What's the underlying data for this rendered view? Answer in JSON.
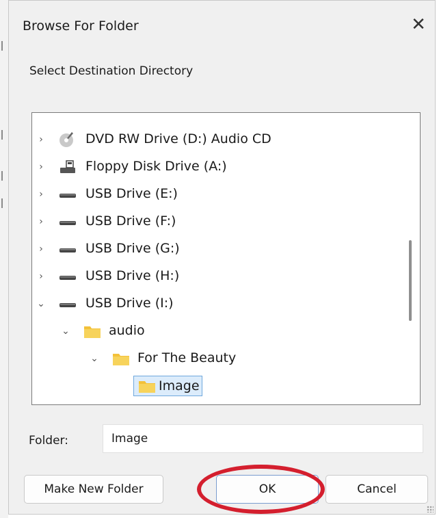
{
  "dialog": {
    "title": "Browse For Folder",
    "instruction": "Select Destination Directory",
    "folder_label": "Folder:",
    "folder_value": "Image",
    "buttons": {
      "make_new_folder": "Make New Folder",
      "ok": "OK",
      "cancel": "Cancel"
    }
  },
  "tree": {
    "items": [
      {
        "label": "DVD RW Drive (D:) Audio CD",
        "icon": "dvd-drive-icon",
        "expander": "collapsed"
      },
      {
        "label": "Floppy Disk Drive (A:)",
        "icon": "floppy-drive-icon",
        "expander": "collapsed"
      },
      {
        "label": "USB Drive (E:)",
        "icon": "usb-drive-icon",
        "expander": "collapsed"
      },
      {
        "label": "USB Drive (F:)",
        "icon": "usb-drive-icon",
        "expander": "collapsed"
      },
      {
        "label": "USB Drive (G:)",
        "icon": "usb-drive-icon",
        "expander": "collapsed"
      },
      {
        "label": "USB Drive (H:)",
        "icon": "usb-drive-icon",
        "expander": "collapsed"
      },
      {
        "label": "USB Drive (I:)",
        "icon": "usb-drive-icon",
        "expander": "expanded"
      },
      {
        "label": "audio",
        "icon": "folder-icon",
        "expander": "expanded"
      },
      {
        "label": "For The Beauty",
        "icon": "folder-icon",
        "expander": "expanded"
      },
      {
        "label": "Image",
        "icon": "folder-icon",
        "expander": "none",
        "selected": true
      }
    ]
  },
  "colors": {
    "dialog_bg": "#f0f0f0",
    "selection_bg": "#dcecfb",
    "selection_border": "#6fa8dc",
    "annotation_ring": "#d41f2e"
  }
}
